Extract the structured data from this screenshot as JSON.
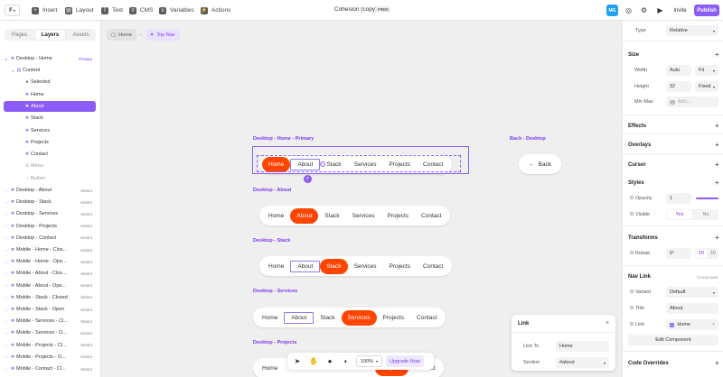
{
  "topbar": {
    "logo": "F",
    "tools": [
      {
        "label": "Insert",
        "icon": "plus-icon"
      },
      {
        "label": "Layout",
        "icon": "layout-icon"
      },
      {
        "label": "Text",
        "icon": "text-icon"
      },
      {
        "label": "CMS",
        "icon": "cms-icon"
      },
      {
        "label": "Variables",
        "icon": "variables-icon"
      },
      {
        "label": "Actions",
        "icon": "actions-icon"
      }
    ],
    "doc_title": "Cohesion (copy)",
    "plan_badge": "FREE",
    "avatar": "MG",
    "invite": "Invite",
    "publish": "Publish"
  },
  "left": {
    "tabs": [
      "Pages",
      "Layers",
      "Assets"
    ],
    "active_tab": "Layers",
    "layers": [
      {
        "label": "Desktop - Home",
        "tag": "Primary"
      },
      {
        "label": "Content",
        "tag": ""
      },
      {
        "label": "Selected",
        "tag": ""
      },
      {
        "label": "Home",
        "tag": ""
      },
      {
        "label": "About",
        "tag": ""
      },
      {
        "label": "Stack",
        "tag": ""
      },
      {
        "label": "Services",
        "tag": ""
      },
      {
        "label": "Projects",
        "tag": ""
      },
      {
        "label": "Contact",
        "tag": ""
      },
      {
        "label": "Menu",
        "tag": ""
      },
      {
        "label": "Button",
        "tag": ""
      },
      {
        "label": "Desktop - About",
        "tag": "Variant"
      },
      {
        "label": "Desktop - Stack",
        "tag": "Variant"
      },
      {
        "label": "Desktop - Services",
        "tag": "Variant"
      },
      {
        "label": "Desktop - Projects",
        "tag": "Variant"
      },
      {
        "label": "Desktop - Contact",
        "tag": "Variant"
      },
      {
        "label": "Mobile - Home - Clos...",
        "tag": "Variant"
      },
      {
        "label": "Mobile - Home - Ope...",
        "tag": "Variant"
      },
      {
        "label": "Mobile - About - Clos...",
        "tag": "Variant"
      },
      {
        "label": "Mobile - About - Ope...",
        "tag": "Variant"
      },
      {
        "label": "Mobile - Stack - Closed",
        "tag": "Variant"
      },
      {
        "label": "Mobile - Stack - Open",
        "tag": "Variant"
      },
      {
        "label": "Mobile - Services - Cl...",
        "tag": "Variant"
      },
      {
        "label": "Mobile - Services - O...",
        "tag": "Variant"
      },
      {
        "label": "Mobile - Projects - Cl...",
        "tag": "Variant"
      },
      {
        "label": "Mobile - Projects - O...",
        "tag": "Variant"
      },
      {
        "label": "Mobile - Contact - Cl...",
        "tag": "Variant"
      }
    ]
  },
  "canvas": {
    "breadcrumb": [
      "Home",
      "Top Nav"
    ],
    "nav_items": [
      "Home",
      "About",
      "Stack",
      "Services",
      "Projects",
      "Contact"
    ],
    "frames": [
      {
        "label": "Desktop - Home - Primary",
        "active": "Home"
      },
      {
        "label": "Desktop - About",
        "active": "About"
      },
      {
        "label": "Desktop - Stack",
        "active": "Stack"
      },
      {
        "label": "Desktop - Services",
        "active": "Services"
      },
      {
        "label": "Desktop - Projects",
        "active": "Projects"
      }
    ],
    "back_frame_label": "Back - Desktop",
    "back_label": "Back",
    "zoom": "100%",
    "upgrade": "Upgrade Now",
    "link_popup": {
      "title": "Link",
      "link_to_label": "Link To",
      "link_to_value": "Home",
      "section_label": "Section",
      "section_value": "#about"
    }
  },
  "right": {
    "type_label": "Type",
    "type_value": "Relative",
    "size_title": "Size",
    "width_label": "Width",
    "width_value": "Auto",
    "width_mode": "Fit",
    "height_label": "Height",
    "height_value": "32",
    "height_mode": "Fixed",
    "minmax_label": "Min Max",
    "minmax_placeholder": "Add...",
    "effects": "Effects",
    "overlays": "Overlays",
    "cursor": "Cursor",
    "styles": "Styles",
    "opacity_label": "Opacity",
    "opacity_value": "1",
    "visible_label": "Visible",
    "visible_yes": "Yes",
    "visible_no": "No",
    "transforms": "Transforms",
    "rotate_label": "Rotate",
    "rotate_value": "0°",
    "mode_2d": "2D",
    "mode_3d": "3D",
    "navlink": "Nav Link",
    "component_tag": "Component",
    "variant_label": "Variant",
    "variant_value": "Default",
    "title_label": "Title",
    "title_value": "About",
    "link_label": "Link",
    "link_value": "Home",
    "edit_component": "Edit Component",
    "code_overrides": "Code Overrides"
  },
  "colors": {
    "accent": "#8b5cf6",
    "active_nav": "#ff4500",
    "avatar": "#1ea1f2"
  }
}
